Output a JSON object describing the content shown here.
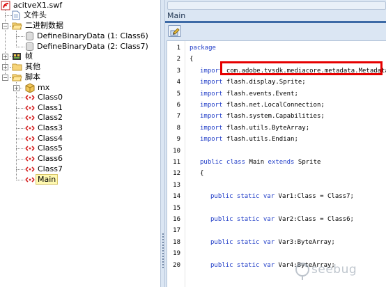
{
  "tree": {
    "root": {
      "label": "acitveX1.swf"
    },
    "items": [
      {
        "label": "文件头"
      },
      {
        "label": "二进制数据"
      },
      {
        "label": "DefineBinaryData (1: Class6)"
      },
      {
        "label": "DefineBinaryData (2: Class7)"
      },
      {
        "label": "帧"
      },
      {
        "label": "其他"
      },
      {
        "label": "脚本"
      },
      {
        "label": "mx"
      },
      {
        "label": "Class0"
      },
      {
        "label": "Class1"
      },
      {
        "label": "Class2"
      },
      {
        "label": "Class3"
      },
      {
        "label": "Class4"
      },
      {
        "label": "Class5"
      },
      {
        "label": "Class6"
      },
      {
        "label": "Class7"
      },
      {
        "label": "Main"
      }
    ],
    "selected": "Main"
  },
  "editor": {
    "tab": "Main",
    "line_numbers": [
      "1",
      "2",
      "3",
      "4",
      "5",
      "6",
      "7",
      "8",
      "9",
      "10",
      "11",
      "12",
      "13",
      "14",
      "15",
      "16",
      "17",
      "18",
      "19",
      "20"
    ],
    "lines": [
      {
        "kw": "package",
        "rest": ""
      },
      {
        "kw": "",
        "rest": "{"
      },
      {
        "kw": "import",
        "rest": " com.adobe.tvsdk.mediacore.metadata.Metadata;"
      },
      {
        "kw": "import",
        "rest": " flash.display.Sprite;"
      },
      {
        "kw": "import",
        "rest": " flash.events.Event;"
      },
      {
        "kw": "import",
        "rest": " flash.net.LocalConnection;"
      },
      {
        "kw": "import",
        "rest": " flash.system.Capabilities;"
      },
      {
        "kw": "import",
        "rest": " flash.utils.ByteArray;"
      },
      {
        "kw": "import",
        "rest": " flash.utils.Endian;"
      },
      {
        "kw": "",
        "rest": ""
      },
      {
        "kw": "public class",
        "rest": " Main ",
        "kw2": "extends",
        "rest2": " Sprite"
      },
      {
        "kw": "",
        "rest": "{"
      },
      {
        "kw": "",
        "rest": ""
      },
      {
        "kw": "public static var",
        "rest": " Var1:Class = Class7;"
      },
      {
        "kw": "",
        "rest": ""
      },
      {
        "kw": "public static var",
        "rest": " Var2:Class = Class6;"
      },
      {
        "kw": "",
        "rest": ""
      },
      {
        "kw": "public static var",
        "rest": " Var3:ByteArray;"
      },
      {
        "kw": "",
        "rest": ""
      },
      {
        "kw": "public static var",
        "rest": " Var4:ByteArray;"
      }
    ]
  },
  "watermark": {
    "text": "seebug"
  },
  "colors": {
    "keyword": "#1f3cc7",
    "highlight_box": "#e60000",
    "selection": "#fff9b0"
  }
}
